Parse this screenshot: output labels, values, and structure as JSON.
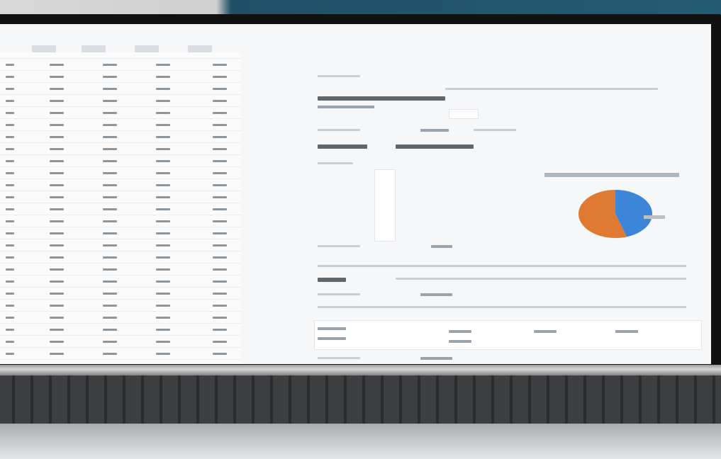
{
  "window": {
    "title": ""
  },
  "left_table": {
    "columns": [
      "",
      "",
      "",
      "",
      ""
    ],
    "rows": 26
  },
  "right_sheet": {
    "section_title": "",
    "pie_chart": {
      "title": "",
      "legend": [
        ""
      ],
      "slices": [
        {
          "label": "",
          "value": 45,
          "color": "#3b86d8"
        },
        {
          "label": "",
          "value": 55,
          "color": "#e07a32"
        }
      ]
    }
  },
  "colors": {
    "bezel": "#111111",
    "screen_bg": "#f6f7f8",
    "pie_blue": "#3b86d8",
    "pie_orange": "#e07a32"
  },
  "icons": [
    "spreadsheet-icon"
  ]
}
